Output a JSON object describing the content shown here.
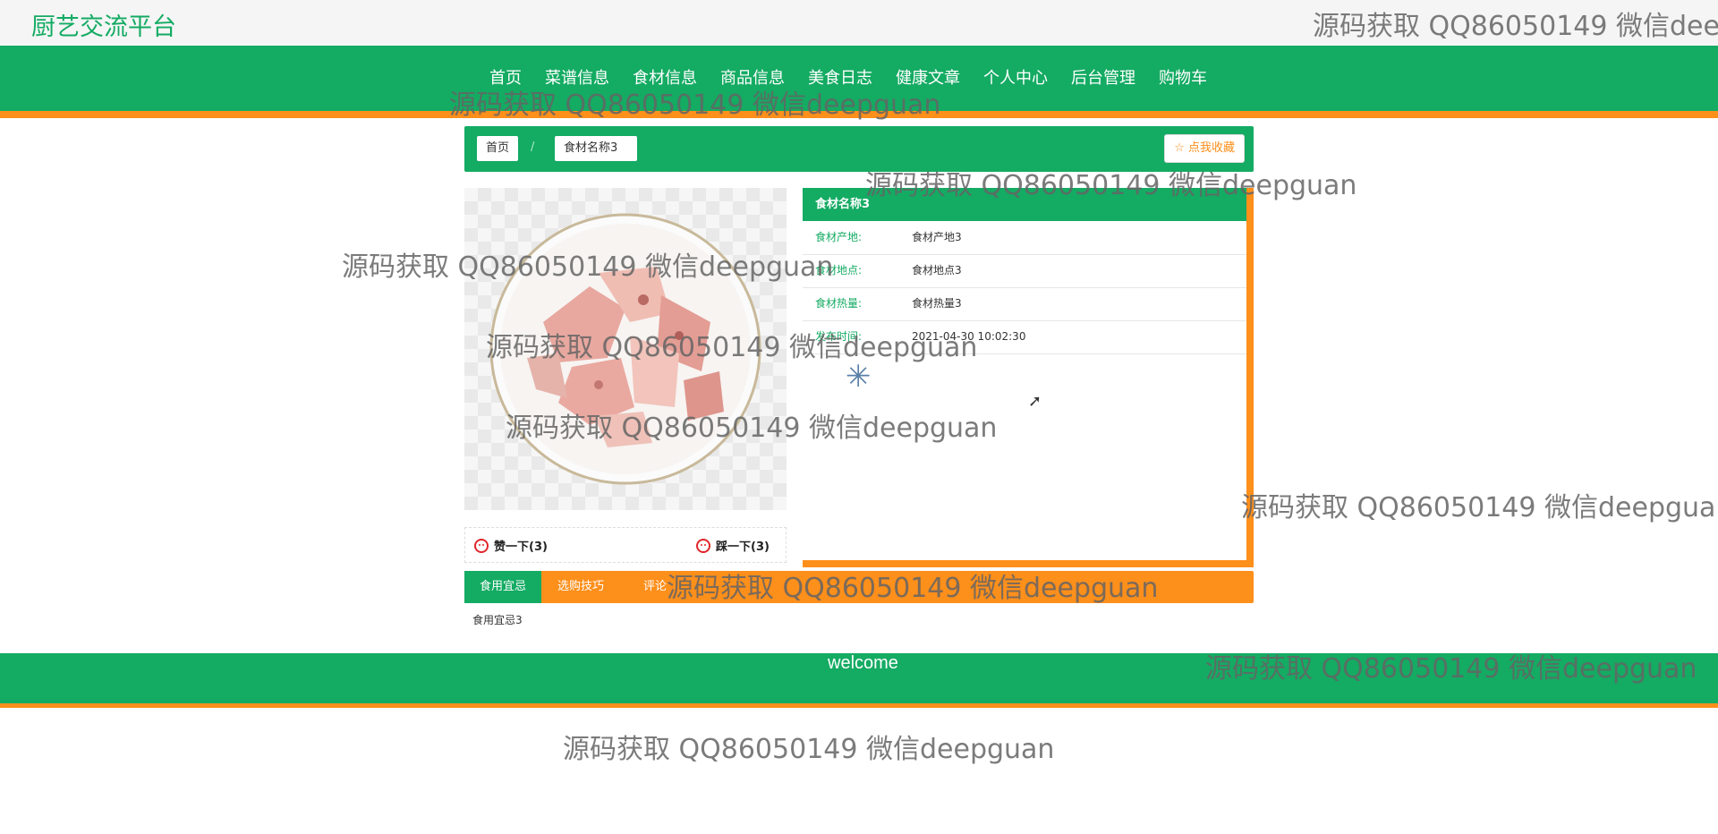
{
  "site": {
    "title": "厨艺交流平台"
  },
  "nav": {
    "items": [
      "首页",
      "菜谱信息",
      "食材信息",
      "商品信息",
      "美食日志",
      "健康文章",
      "个人中心",
      "后台管理",
      "购物车"
    ]
  },
  "breadcrumb": {
    "home": "首页",
    "separator": "/",
    "current": "食材名称3",
    "favorite": "☆ 点我收藏"
  },
  "detail": {
    "title": "食材名称3",
    "rows": [
      {
        "key": "食材产地:",
        "value": "食材产地3"
      },
      {
        "key": "食材地点:",
        "value": "食材地点3"
      },
      {
        "key": "食材热量:",
        "value": "食材热量3"
      },
      {
        "key": "发布时间:",
        "value": "2021-04-30 10:02:30"
      }
    ]
  },
  "votes": {
    "like": "赞一下(3)",
    "dislike": "踩一下(3)"
  },
  "tabs": {
    "items": [
      "食用宜忌",
      "选购技巧",
      "评论"
    ],
    "active_index": 0,
    "content": "食用宜忌3"
  },
  "footer": {
    "text": "welcome"
  },
  "watermark": {
    "text": "源码获取 QQ86050149 微信deepguan",
    "clipped": "源码获取 QQ86050149 微信deep"
  },
  "colors": {
    "primary": "#14ab63",
    "accent": "#fd8f1b"
  }
}
